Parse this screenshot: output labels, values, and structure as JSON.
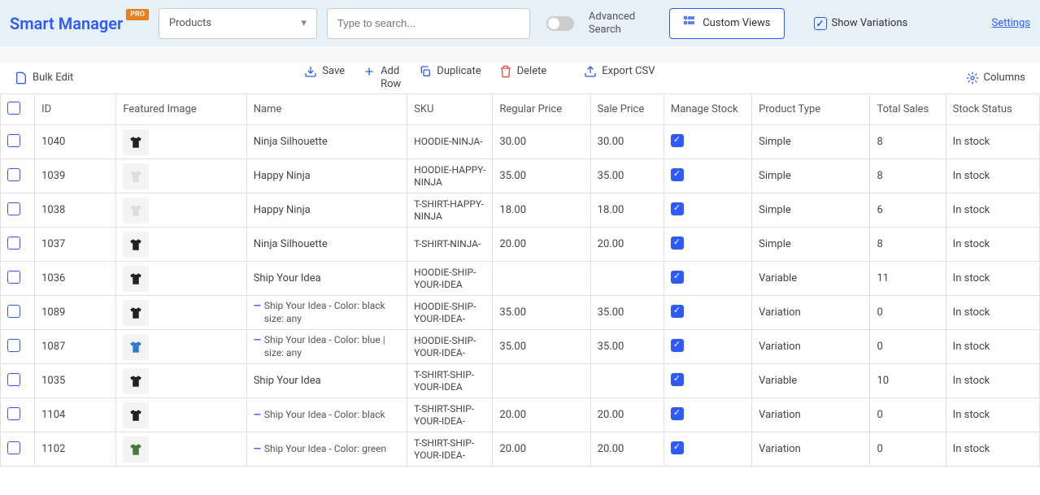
{
  "header": {
    "logo": "Smart Manager",
    "pro": "PRO",
    "dropdown": "Products",
    "search_placeholder": "Type to search...",
    "advanced": "Advanced",
    "search": "Search",
    "custom_views": "Custom Views",
    "show_variations": "Show Variations",
    "settings": "Settings"
  },
  "toolbar": {
    "bulk_edit": "Bulk Edit",
    "save": "Save",
    "add_row": "Add Row",
    "duplicate": "Duplicate",
    "delete": "Delete",
    "export_csv": "Export CSV",
    "columns": "Columns"
  },
  "columns": {
    "id": "ID",
    "featured_image": "Featured Image",
    "name": "Name",
    "sku": "SKU",
    "regular_price": "Regular Price",
    "sale_price": "Sale Price",
    "manage_stock": "Manage Stock",
    "product_type": "Product Type",
    "total_sales": "Total Sales",
    "stock_status": "Stock Status"
  },
  "rows": [
    {
      "id": "1040",
      "name": "Ninja Silhouette",
      "sku": "HOODIE-NINJA-",
      "rprice": "30.00",
      "sprice": "30.00",
      "mstock": true,
      "ptype": "Simple",
      "sales": "8",
      "stock": "In stock",
      "color": "#222",
      "variation": false
    },
    {
      "id": "1039",
      "name": "Happy Ninja",
      "sku": "HOODIE-HAPPY-NINJA",
      "rprice": "35.00",
      "sprice": "35.00",
      "mstock": true,
      "ptype": "Simple",
      "sales": "8",
      "stock": "In stock",
      "color": "#ddd",
      "variation": false
    },
    {
      "id": "1038",
      "name": "Happy Ninja",
      "sku": "T-SHIRT-HAPPY-NINJA",
      "rprice": "18.00",
      "sprice": "18.00",
      "mstock": true,
      "ptype": "Simple",
      "sales": "6",
      "stock": "In stock",
      "color": "#ddd",
      "variation": false
    },
    {
      "id": "1037",
      "name": "Ninja Silhouette",
      "sku": "T-SHIRT-NINJA-",
      "rprice": "20.00",
      "sprice": "20.00",
      "mstock": true,
      "ptype": "Simple",
      "sales": "8",
      "stock": "In stock",
      "color": "#222",
      "variation": false
    },
    {
      "id": "1036",
      "name": "Ship Your Idea",
      "sku": "HOODIE-SHIP-YOUR-IDEA",
      "rprice": "",
      "sprice": "",
      "mstock": true,
      "ptype": "Variable",
      "sales": "11",
      "stock": "In stock",
      "color": "#222",
      "variation": false
    },
    {
      "id": "1089",
      "name": "Ship Your Idea - Color: black size: any",
      "sku": "HOODIE-SHIP-YOUR-IDEA-",
      "rprice": "35.00",
      "sprice": "35.00",
      "mstock": true,
      "ptype": "Variation",
      "sales": "0",
      "stock": "In stock",
      "color": "#222",
      "variation": true
    },
    {
      "id": "1087",
      "name": "Ship Your Idea - Color: blue | size: any",
      "sku": "HOODIE-SHIP-YOUR-IDEA-",
      "rprice": "35.00",
      "sprice": "35.00",
      "mstock": true,
      "ptype": "Variation",
      "sales": "0",
      "stock": "In stock",
      "color": "#2e7bd6",
      "variation": true
    },
    {
      "id": "1035",
      "name": "Ship Your Idea",
      "sku": "T-SHIRT-SHIP-YOUR-IDEA",
      "rprice": "",
      "sprice": "",
      "mstock": true,
      "ptype": "Variable",
      "sales": "10",
      "stock": "In stock",
      "color": "#222",
      "variation": false
    },
    {
      "id": "1104",
      "name": "Ship Your Idea - Color: black",
      "sku": "T-SHIRT-SHIP-YOUR-IDEA-",
      "rprice": "20.00",
      "sprice": "20.00",
      "mstock": true,
      "ptype": "Variation",
      "sales": "0",
      "stock": "In stock",
      "color": "#222",
      "variation": true
    },
    {
      "id": "1102",
      "name": "Ship Your Idea - Color: green",
      "sku": "T-SHIRT-SHIP-YOUR-IDEA-",
      "rprice": "20.00",
      "sprice": "20.00",
      "mstock": true,
      "ptype": "Variation",
      "sales": "0",
      "stock": "In stock",
      "color": "#4a7a3a",
      "variation": true
    }
  ]
}
